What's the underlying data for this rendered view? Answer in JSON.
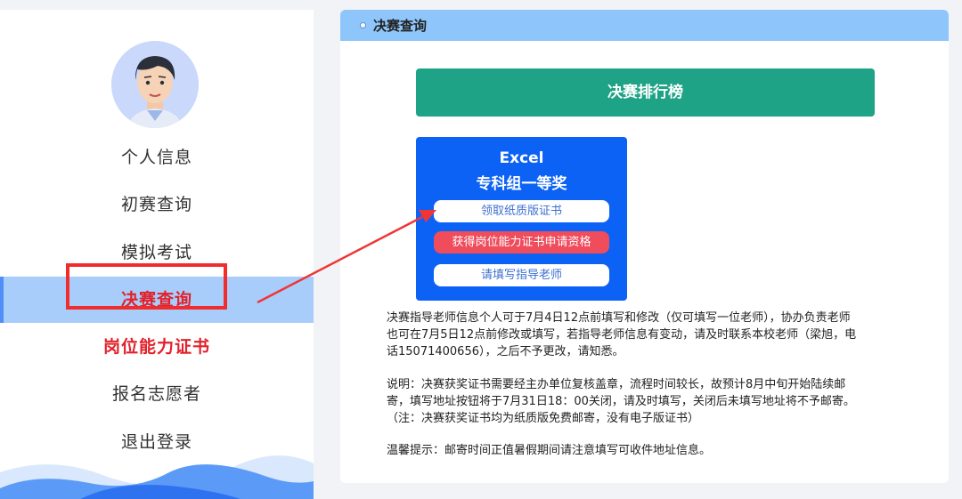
{
  "sidebar": {
    "menu": [
      {
        "label": "个人信息"
      },
      {
        "label": "初赛查询"
      },
      {
        "label": "模拟考试"
      },
      {
        "label": "决赛查询"
      },
      {
        "label": "岗位能力证书"
      },
      {
        "label": "报名志愿者"
      },
      {
        "label": "退出登录"
      }
    ],
    "active_index": 3
  },
  "panel": {
    "title": "决赛查询",
    "rank_button": "决赛排行榜",
    "award": {
      "line1": "Excel",
      "line2": "专科组一等奖",
      "btn_paper": "领取纸质版证书",
      "btn_qualify": "获得岗位能力证书申请资格",
      "btn_teacher": "请填写指导老师"
    },
    "notes": {
      "teacher_1": "决赛指导老师信息个人可于7月4日12点前填写和修改（仅可填写一位老师），协办负责老师",
      "teacher_2": "也可在7月5日12点前修改或填写，若指导老师信息有变动，请及时联系本校老师（梁旭，电",
      "teacher_3": "话15071400656），之后不予更改，请知悉。",
      "desc_1": "说明：决赛获奖证书需要经主办单位复核盖章，流程时间较长，故预计8月中旬开始陆续邮",
      "desc_2": "寄，填写地址按钮将于7月31日18：00关闭，请及时填写，关闭后未填写地址将不予邮寄。",
      "desc_3": "（注：决赛获奖证书均为纸质版免费邮寄，没有电子版证书）",
      "tip": "温馨提示：邮寄时间正值暑假期间请注意填写可收件地址信息。"
    }
  },
  "colors": {
    "header": "#8ec6fb",
    "rank_button": "#1ea386",
    "award_card": "#0c62f5",
    "highlight": "#f02c2c",
    "active_menu": "#a8cdfb"
  }
}
